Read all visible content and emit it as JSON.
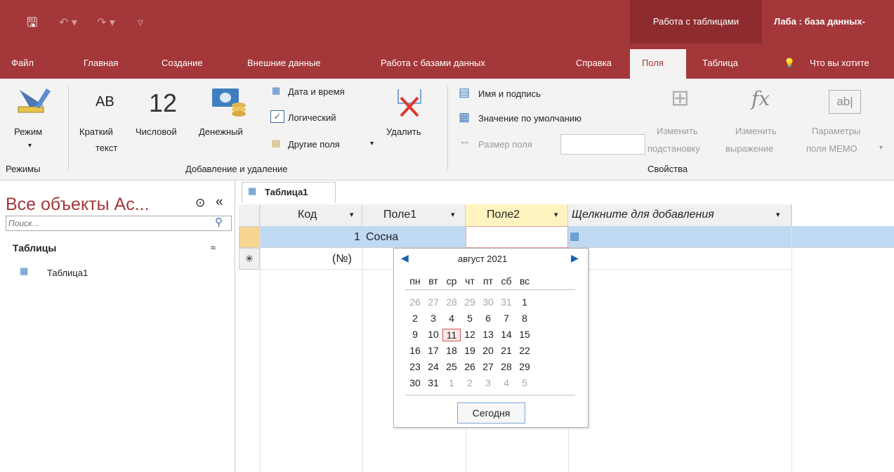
{
  "titlebar": {
    "context_group": "Работа с таблицами",
    "document_title": "Лаба : база данных-"
  },
  "ribbon_tabs": [
    "Файл",
    "Главная",
    "Создание",
    "Внешние данные",
    "Работа с базами данных",
    "Справка",
    "Поля",
    "Таблица",
    "Что вы хотите"
  ],
  "ribbon": {
    "view": {
      "label": "Режим",
      "group": "Режимы"
    },
    "add": {
      "short_text_icon": "AB",
      "short_text": "Краткий",
      "short_text2": "текст",
      "number_icon": "12",
      "number": "Числовой",
      "currency": "Денежный",
      "datetime": "Дата и время",
      "logical": "Логический",
      "other": "Другие поля",
      "delete": "Удалить",
      "group": "Добавление и удаление"
    },
    "props": {
      "name_caption": "Имя и подпись",
      "default_value": "Значение по умолчанию",
      "field_size": "Размер поля",
      "modify_lookup": "Изменить",
      "modify_lookup2": "подстановку",
      "modify_expr": "Изменить",
      "modify_expr2": "выражение",
      "memo": "Параметры",
      "memo2": "поля MEMO",
      "group": "Свойства"
    }
  },
  "nav": {
    "title": "Все объекты Ac...",
    "search_placeholder": "Поиск...",
    "section": "Таблицы",
    "item": "Таблица1"
  },
  "document_tab": "Таблица1",
  "table": {
    "columns": [
      "Код",
      "Поле1",
      "Поле2",
      "Щелкните для добавления"
    ],
    "row1": {
      "id": "1",
      "pole1": "Сосна"
    },
    "new_row": "(№)"
  },
  "date_picker": {
    "month": "август 2021",
    "weekdays": [
      "пн",
      "вт",
      "ср",
      "чт",
      "пт",
      "сб",
      "вс"
    ],
    "weeks": [
      [
        "26",
        "27",
        "28",
        "29",
        "30",
        "31",
        "1"
      ],
      [
        "2",
        "3",
        "4",
        "5",
        "6",
        "7",
        "8"
      ],
      [
        "9",
        "10",
        "11",
        "12",
        "13",
        "14",
        "15"
      ],
      [
        "16",
        "17",
        "18",
        "19",
        "20",
        "21",
        "22"
      ],
      [
        "23",
        "24",
        "25",
        "26",
        "27",
        "28",
        "29"
      ],
      [
        "30",
        "31",
        "1",
        "2",
        "3",
        "4",
        "5"
      ]
    ],
    "selected": "11",
    "today_button": "Сегодня"
  },
  "colors": {
    "accent": "#a4373a",
    "context": "#8e2b2e",
    "selected_row": "#bfd9f2",
    "active_header": "#fff3c0"
  }
}
